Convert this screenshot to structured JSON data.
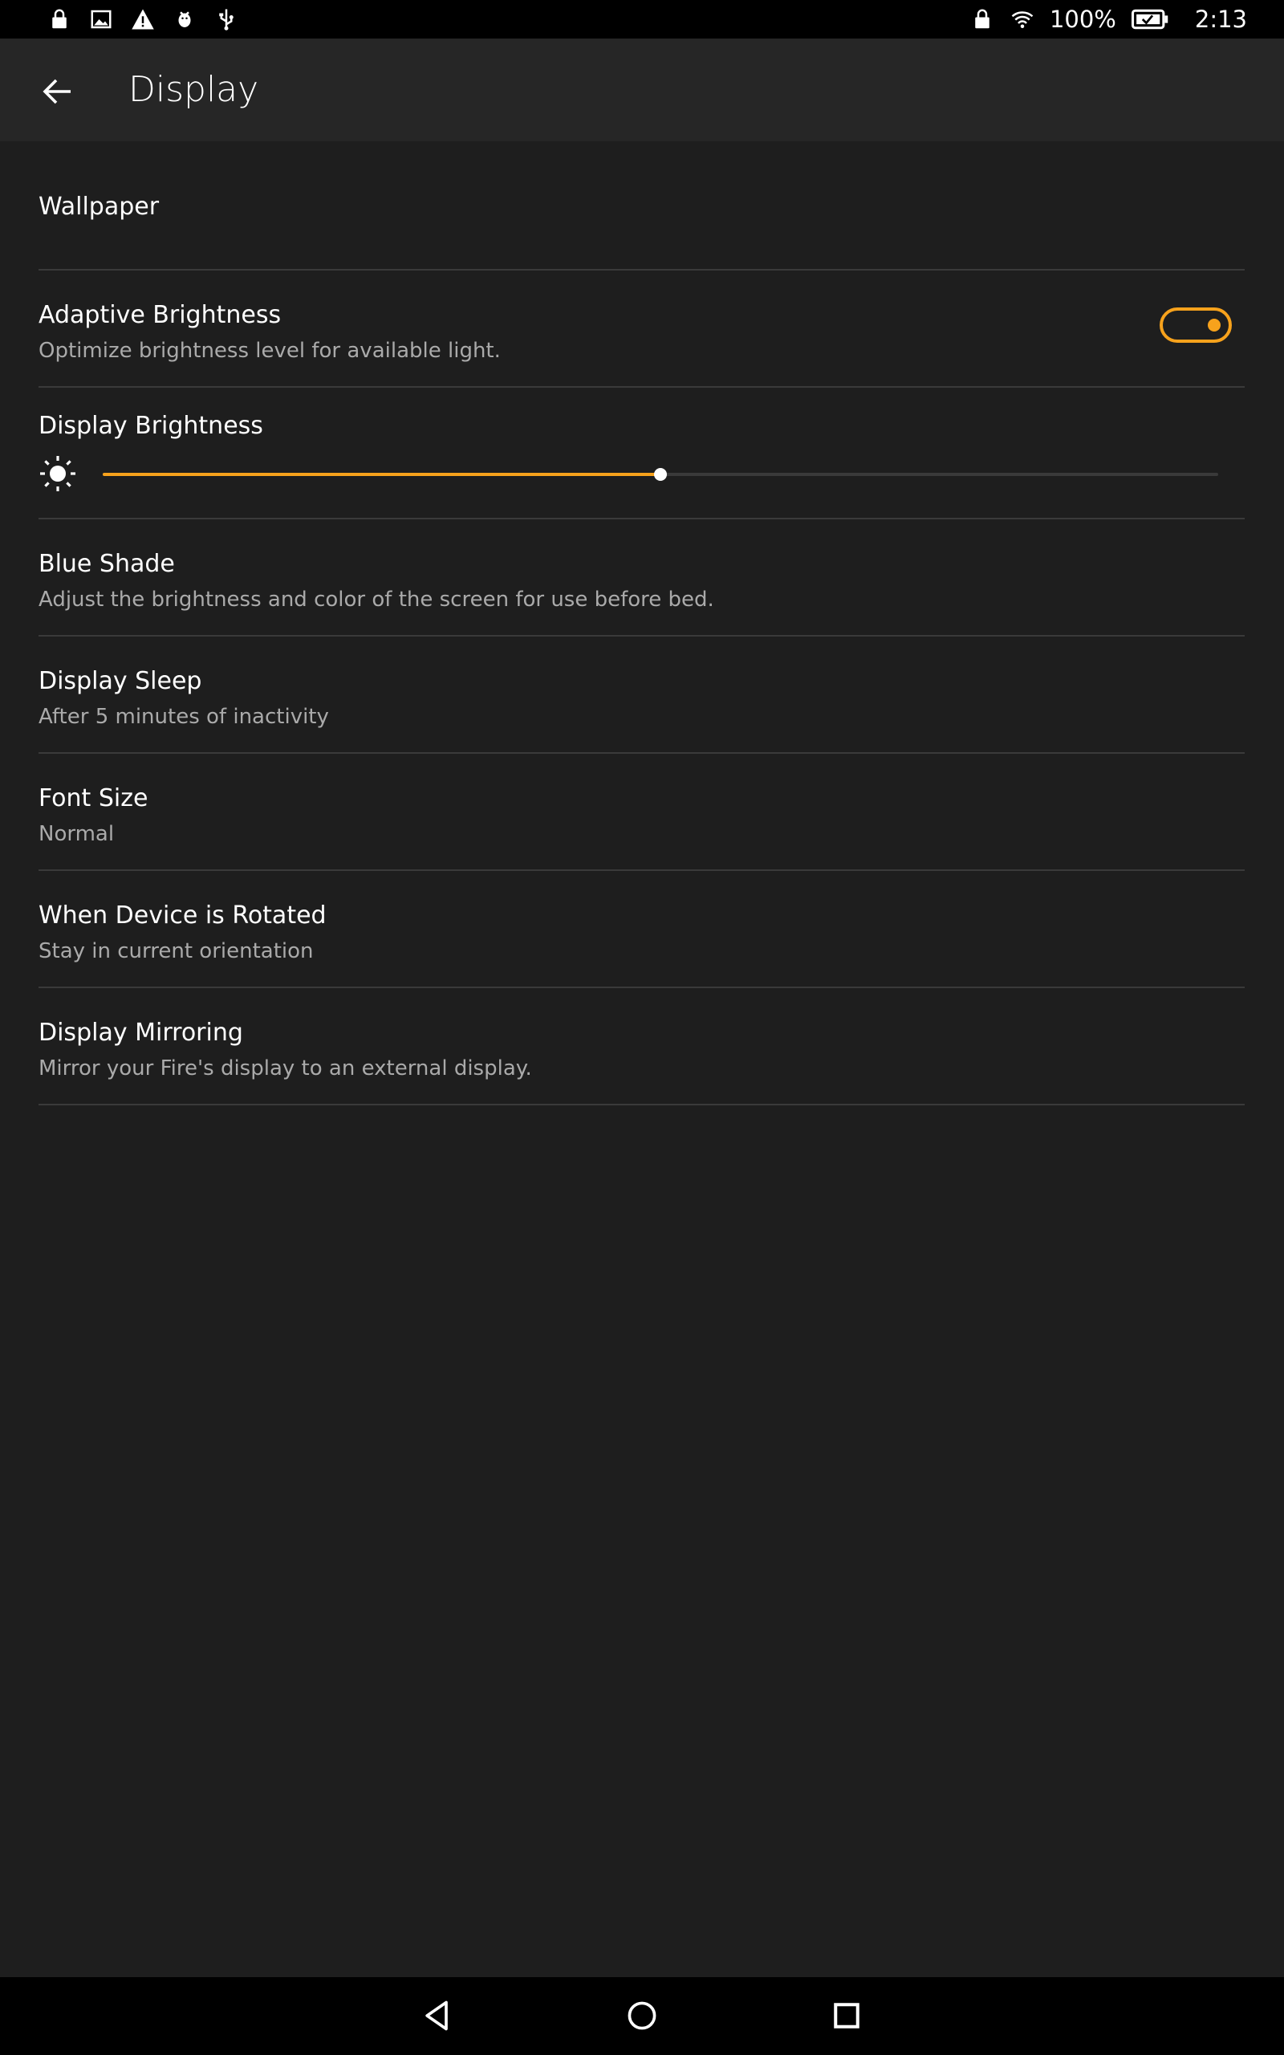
{
  "status_bar": {
    "left_icons": [
      "lock-icon",
      "image-icon",
      "warning-icon",
      "debug-icon",
      "usb-icon"
    ],
    "right_icons": [
      "lock-icon",
      "wifi-icon",
      "battery-icon"
    ],
    "battery_percent": "100%",
    "time": "2:13"
  },
  "header": {
    "title": "Display"
  },
  "settings": {
    "wallpaper": {
      "title": "Wallpaper"
    },
    "adaptive_brightness": {
      "title": "Adaptive Brightness",
      "subtitle": "Optimize brightness level for available light.",
      "enabled": true
    },
    "display_brightness": {
      "title": "Display Brightness",
      "level": 0.5
    },
    "blue_shade": {
      "title": "Blue Shade",
      "subtitle": "Adjust the brightness and color of the screen for use before bed."
    },
    "display_sleep": {
      "title": "Display Sleep",
      "subtitle": "After 5 minutes of inactivity"
    },
    "font_size": {
      "title": "Font Size",
      "subtitle": "Normal"
    },
    "rotation": {
      "title": "When Device is Rotated",
      "subtitle": "Stay in current orientation"
    },
    "mirroring": {
      "title": "Display Mirroring",
      "subtitle": "Mirror your Fire's display to an external display."
    }
  },
  "colors": {
    "accent": "#f7a21c",
    "background": "#1e1e1e",
    "header": "#262626"
  },
  "nav_bar": {
    "icons": [
      "back-icon",
      "home-icon",
      "recents-icon"
    ]
  }
}
